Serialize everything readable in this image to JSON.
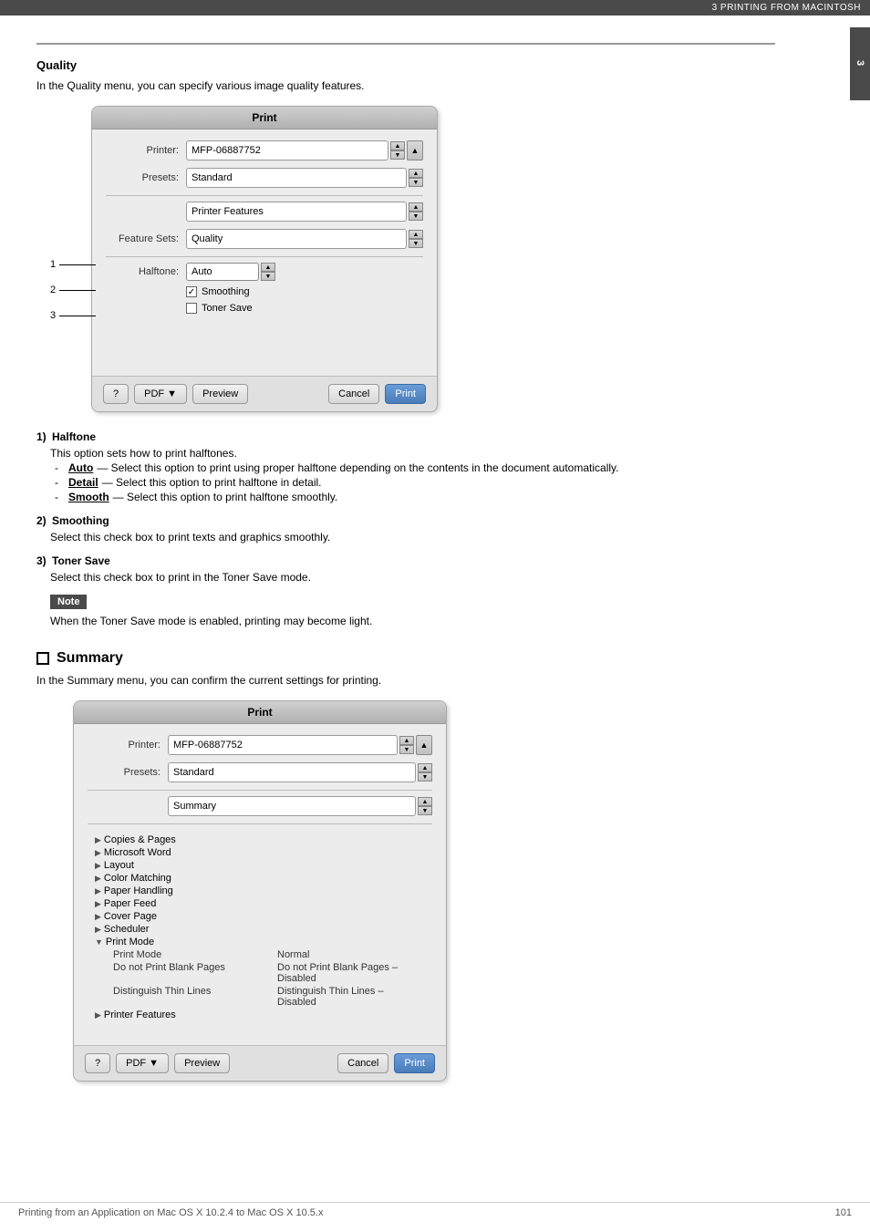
{
  "topbar": {
    "label": "3 PRINTING FROM MACINTOSH"
  },
  "chapter_number": "3",
  "quality_section": {
    "title": "Quality",
    "intro": "In the Quality menu, you can specify various image quality features.",
    "dialog": {
      "title": "Print",
      "printer_label": "Printer:",
      "printer_value": "MFP-06887752",
      "presets_label": "Presets:",
      "presets_value": "Standard",
      "feature_menu": "Printer Features",
      "feature_sets_label": "Feature Sets:",
      "feature_sets_value": "Quality",
      "halftone_label": "Halftone:",
      "halftone_value": "Auto",
      "smoothing_label": "Smoothing",
      "smoothing_checked": true,
      "toner_label": "Toner Save",
      "toner_checked": false,
      "pdf_btn": "PDF ▼",
      "preview_btn": "Preview",
      "cancel_btn": "Cancel",
      "print_btn": "Print"
    },
    "callout_1": "1",
    "callout_2": "2",
    "callout_3": "3"
  },
  "halftone_section": {
    "number": "1)",
    "title": "Halftone",
    "desc": "This option sets how to print halftones.",
    "options": [
      {
        "term": "Auto",
        "desc": "— Select this option to print using proper halftone depending on the contents in the document automatically."
      },
      {
        "term": "Detail",
        "desc": "— Select this option to print halftone in detail."
      },
      {
        "term": "Smooth",
        "desc": "— Select this option to print halftone smoothly."
      }
    ]
  },
  "smoothing_section": {
    "number": "2)",
    "title": "Smoothing",
    "desc": "Select this check box to print texts and graphics smoothly."
  },
  "toner_section": {
    "number": "3)",
    "title": "Toner Save",
    "desc": "Select this check box to print in the Toner Save mode."
  },
  "note": {
    "label": "Note",
    "text": "When the Toner Save mode is enabled, printing may become light."
  },
  "summary_section": {
    "title": "Summary",
    "intro": "In the Summary menu, you can confirm the current settings for printing.",
    "dialog": {
      "title": "Print",
      "printer_label": "Printer:",
      "printer_value": "MFP-06887752",
      "presets_label": "Presets:",
      "presets_value": "Standard",
      "menu_value": "Summary",
      "pdf_btn": "PDF ▼",
      "preview_btn": "Preview",
      "cancel_btn": "Cancel",
      "print_btn": "Print",
      "list_items": [
        {
          "type": "collapsed",
          "label": "Copies & Pages"
        },
        {
          "type": "collapsed",
          "label": "Microsoft Word"
        },
        {
          "type": "collapsed",
          "label": "Layout"
        },
        {
          "type": "collapsed",
          "label": "Color Matching"
        },
        {
          "type": "collapsed",
          "label": "Paper Handling"
        },
        {
          "type": "collapsed",
          "label": "Paper Feed"
        },
        {
          "type": "collapsed",
          "label": "Cover Page"
        },
        {
          "type": "collapsed",
          "label": "Scheduler"
        },
        {
          "type": "expanded",
          "label": "Print Mode"
        }
      ],
      "details": [
        {
          "key": "Print Mode",
          "value": "Normal"
        },
        {
          "key": "Do not Print Blank Pages",
          "value": "Do not Print Blank Pages – Disabled"
        },
        {
          "key": "Distinguish Thin Lines",
          "value": "Distinguish Thin Lines – Disabled"
        }
      ],
      "printer_features": {
        "type": "collapsed",
        "label": "Printer Features"
      }
    }
  },
  "page_footer": {
    "left": "Printing from an Application on Mac OS X 10.2.4 to Mac OS X 10.5.x",
    "right": "101"
  }
}
